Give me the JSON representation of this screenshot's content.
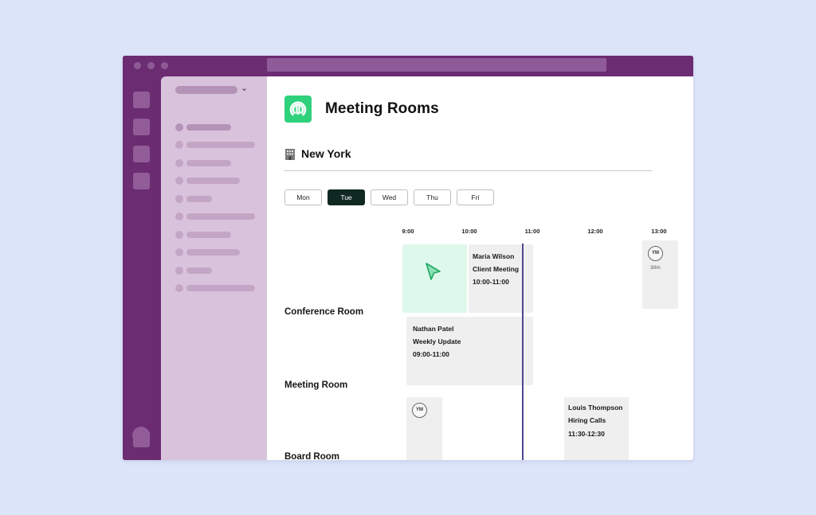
{
  "app": {
    "title": "Meeting Rooms"
  },
  "location": {
    "icon": "office-building-icon",
    "name": "New York"
  },
  "days": [
    {
      "label": "Mon",
      "active": false
    },
    {
      "label": "Tue",
      "active": true
    },
    {
      "label": "Wed",
      "active": false
    },
    {
      "label": "Thu",
      "active": false
    },
    {
      "label": "Fri",
      "active": false
    }
  ],
  "times": [
    "9:00",
    "10:00",
    "11:00",
    "12:00",
    "13:00"
  ],
  "rooms": [
    "Conference Room",
    "Meeting Room",
    "Board Room"
  ],
  "bookings": {
    "conference_main": {
      "name": "Maria Wilson",
      "title": "Client Meeting",
      "time": "10:00-11:00"
    },
    "conference_short": {
      "initials": "YM",
      "duration": "30m"
    },
    "meeting_main": {
      "name": "Nathan Patel",
      "title": "Weekly Update",
      "time": "09:00-11:00"
    },
    "board_short": {
      "initials": "YM"
    },
    "board_main": {
      "name": "Louis Thompson",
      "title": "Hiring Calls",
      "time": "11:30-12:30"
    }
  },
  "colors": {
    "window": "#6b2c72",
    "sidebar": "#d9c3dc",
    "logo": "#2fd17c",
    "active_tab": "#102822",
    "free_slot": "#dff8ec",
    "booking": "#efefef",
    "now_line": "#4a4a90"
  }
}
